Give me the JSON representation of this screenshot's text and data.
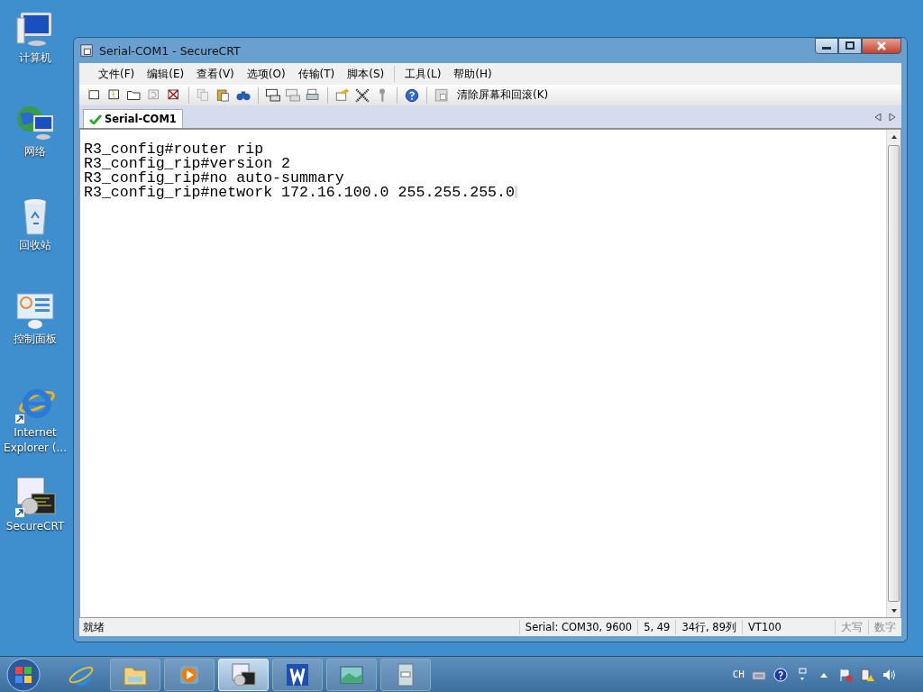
{
  "desktop_icons": [
    {
      "label": "计算机"
    },
    {
      "label": "网络"
    },
    {
      "label": "回收站"
    },
    {
      "label": "控制面板"
    },
    {
      "label": "Internet Explorer (..."
    },
    {
      "label": "SecureCRT"
    }
  ],
  "window": {
    "title": "Serial-COM1 - SecureCRT"
  },
  "menu": [
    "文件(F)",
    "编辑(E)",
    "查看(V)",
    "选项(O)",
    "传输(T)",
    "脚本(S)",
    "工具(L)",
    "帮助(H)"
  ],
  "toolbar": {
    "clear_button": "清除屏幕和回滚(K)"
  },
  "tabs": [
    {
      "label": "Serial-COM1",
      "selected": true
    }
  ],
  "terminal": {
    "lines": [
      "R3_config#router rip",
      "R3_config_rip#version 2",
      "R3_config_rip#no auto-summary",
      "R3_config_rip#network 172.16.100.0 255.255.255.0"
    ]
  },
  "status_bar": {
    "message": "就绪",
    "connection": "Serial: COM30, 9600",
    "cursor": "5,  49",
    "size": "34行, 89列",
    "emulation": "VT100",
    "indicators": [
      {
        "label": "大写",
        "on": false
      },
      {
        "label": "数字",
        "on": false
      }
    ]
  },
  "taskbar": {
    "buttons": [
      {
        "selected": false
      },
      {
        "selected": false
      },
      {
        "selected": false
      },
      {
        "selected": true
      },
      {
        "selected": false
      },
      {
        "selected": false
      },
      {
        "selected": false
      }
    ],
    "tray": {
      "language": "CH"
    }
  }
}
